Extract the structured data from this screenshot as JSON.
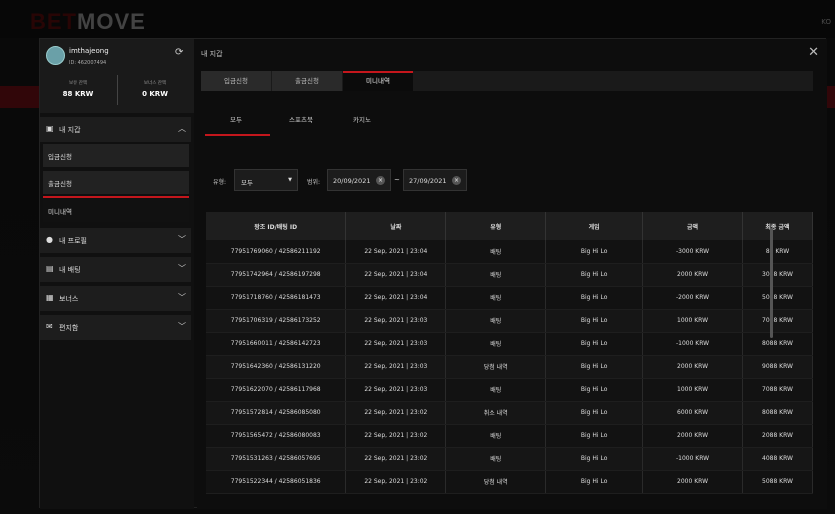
{
  "brand": {
    "logo_left": "BET",
    "logo_right": "MOVE"
  },
  "lang": "KO",
  "profile": {
    "username": "imthajeong",
    "user_id": "ID: 462007494",
    "refresh_icon": "refresh-icon"
  },
  "balances": [
    {
      "label": "보유 잔액",
      "value": "88 KRW"
    },
    {
      "label": "보너스 잔액",
      "value": "0 KRW"
    }
  ],
  "sidebar": {
    "wallet": {
      "label": "내 지갑",
      "icon": "wallet-icon"
    },
    "wallet_items": [
      {
        "label": "입금신청"
      },
      {
        "label": "출금신청"
      },
      {
        "label": "미니내역"
      }
    ],
    "items": [
      {
        "label": "내 프로필",
        "icon": "user-icon"
      },
      {
        "label": "내 배팅",
        "icon": "clipboard-icon"
      },
      {
        "label": "보너스",
        "icon": "gift-icon"
      },
      {
        "label": "편지함",
        "icon": "mail-icon"
      }
    ]
  },
  "main": {
    "title": "내 지갑",
    "tabs": [
      {
        "label": "입금신청"
      },
      {
        "label": "출금신청"
      },
      {
        "label": "미니내역"
      }
    ],
    "subtabs": [
      {
        "label": "모두"
      },
      {
        "label": "스포츠북"
      },
      {
        "label": "카지노"
      }
    ],
    "filter": {
      "type_label": "유형:",
      "type_value": "모두",
      "period_label": "범위:",
      "date_from": "20/09/2021",
      "date_to": "27/09/2021",
      "tilde": "~"
    },
    "table": {
      "columns": [
        "왕조 ID/배팅 ID",
        "날짜",
        "유형",
        "게임",
        "금액",
        "최종 금액"
      ],
      "rows": [
        [
          "77951769060 / 42586211192",
          "22 Sep, 2021 | 23:04",
          "배팅",
          "Big Hi Lo",
          "-3000 KRW",
          "88 KRW"
        ],
        [
          "77951742964 / 42586197298",
          "22 Sep, 2021 | 23:04",
          "배팅",
          "Big Hi Lo",
          "2000 KRW",
          "3088 KRW"
        ],
        [
          "77951718760 / 42586181473",
          "22 Sep, 2021 | 23:04",
          "배팅",
          "Big Hi Lo",
          "-2000 KRW",
          "5088 KRW"
        ],
        [
          "77951706319 / 42586173252",
          "22 Sep, 2021 | 23:03",
          "배팅",
          "Big Hi Lo",
          "1000 KRW",
          "7088 KRW"
        ],
        [
          "77951660011 / 42586142723",
          "22 Sep, 2021 | 23:03",
          "배팅",
          "Big Hi Lo",
          "-1000 KRW",
          "8088 KRW"
        ],
        [
          "77951642360 / 42586131220",
          "22 Sep, 2021 | 23:03",
          "당첨 내역",
          "Big Hi Lo",
          "2000 KRW",
          "9088 KRW"
        ],
        [
          "77951622070 / 42586117968",
          "22 Sep, 2021 | 23:03",
          "배팅",
          "Big Hi Lo",
          "1000 KRW",
          "7088 KRW"
        ],
        [
          "77951572814 / 42586085080",
          "22 Sep, 2021 | 23:02",
          "취소 내역",
          "Big Hi Lo",
          "6000 KRW",
          "8088 KRW"
        ],
        [
          "77951565472 / 42586080083",
          "22 Sep, 2021 | 23:02",
          "배팅",
          "Big Hi Lo",
          "2000 KRW",
          "2088 KRW"
        ],
        [
          "77951531263 / 42586057695",
          "22 Sep, 2021 | 23:02",
          "배팅",
          "Big Hi Lo",
          "-1000 KRW",
          "4088 KRW"
        ],
        [
          "77951522344 / 42586051836",
          "22 Sep, 2021 | 23:02",
          "당첨 내역",
          "Big Hi Lo",
          "2000 KRW",
          "5088 KRW"
        ]
      ]
    }
  },
  "colors": {
    "accent": "#c4161c",
    "panel": "#1d1d1d"
  }
}
